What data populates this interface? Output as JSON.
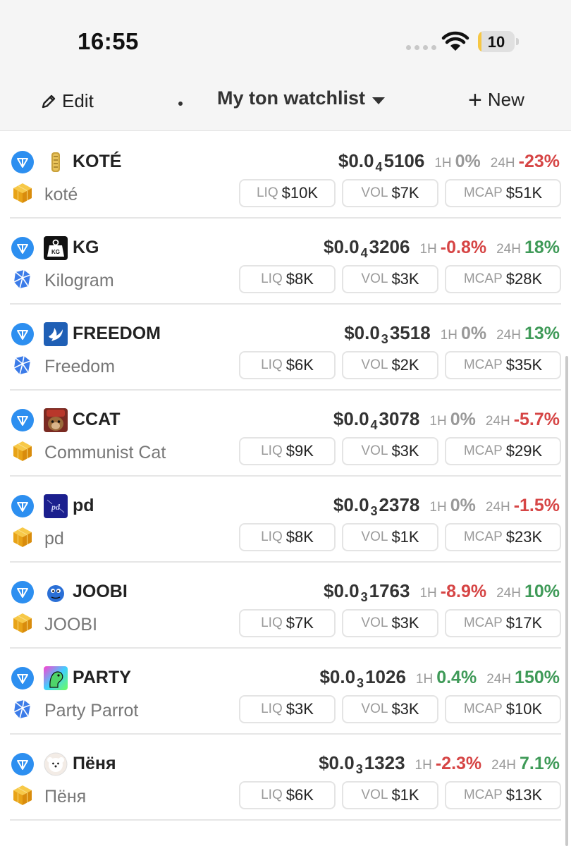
{
  "status_bar": {
    "time": "16:55",
    "battery": "10",
    "battery_level": 0.1
  },
  "header": {
    "edit_label": "Edit",
    "title": "My ton watchlist",
    "new_label": "New"
  },
  "labels": {
    "liq": "LIQ",
    "vol": "VOL",
    "mcap": "MCAP",
    "h1": "1H",
    "h24": "24H"
  },
  "tokens": [
    {
      "symbol": "KOTÉ",
      "name": "koté",
      "price_prefix": "$0.0",
      "price_sub": "4",
      "price_main": "5106",
      "change_1h": "0%",
      "change_1h_dir": "zero",
      "change_24h": "-23%",
      "change_24h_dir": "neg",
      "liq": "$10K",
      "vol": "$7K",
      "mcap": "$51K",
      "dex": "cube-icon",
      "logo": "coin-icon"
    },
    {
      "symbol": "KG",
      "name": "Kilogram",
      "price_prefix": "$0.0",
      "price_sub": "4",
      "price_main": "3206",
      "change_1h": "-0.8%",
      "change_1h_dir": "neg",
      "change_24h": "18%",
      "change_24h_dir": "pos",
      "liq": "$8K",
      "vol": "$3K",
      "mcap": "$28K",
      "dex": "stonfi-icon",
      "logo": "kg-weight-icon"
    },
    {
      "symbol": "FREEDOM",
      "name": "Freedom",
      "price_prefix": "$0.0",
      "price_sub": "3",
      "price_main": "3518",
      "change_1h": "0%",
      "change_1h_dir": "zero",
      "change_24h": "13%",
      "change_24h_dir": "pos",
      "liq": "$6K",
      "vol": "$2K",
      "mcap": "$35K",
      "dex": "stonfi-icon",
      "logo": "dove-icon"
    },
    {
      "symbol": "CCAT",
      "name": "Communist Cat",
      "price_prefix": "$0.0",
      "price_sub": "4",
      "price_main": "3078",
      "change_1h": "0%",
      "change_1h_dir": "zero",
      "change_24h": "-5.7%",
      "change_24h_dir": "neg",
      "liq": "$9K",
      "vol": "$3K",
      "mcap": "$29K",
      "dex": "cube-icon",
      "logo": "cat-icon"
    },
    {
      "symbol": "pd",
      "name": "pd",
      "price_prefix": "$0.0",
      "price_sub": "3",
      "price_main": "2378",
      "change_1h": "0%",
      "change_1h_dir": "zero",
      "change_24h": "-1.5%",
      "change_24h_dir": "neg",
      "liq": "$8K",
      "vol": "$1K",
      "mcap": "$23K",
      "dex": "cube-icon",
      "logo": "pd-icon"
    },
    {
      "symbol": "JOOBI",
      "name": "JOOBI",
      "price_prefix": "$0.0",
      "price_sub": "3",
      "price_main": "1763",
      "change_1h": "-8.9%",
      "change_1h_dir": "neg",
      "change_24h": "10%",
      "change_24h_dir": "pos",
      "liq": "$7K",
      "vol": "$3K",
      "mcap": "$17K",
      "dex": "cube-icon",
      "logo": "blue-ball-icon"
    },
    {
      "symbol": "PARTY",
      "name": "Party Parrot",
      "price_prefix": "$0.0",
      "price_sub": "3",
      "price_main": "1026",
      "change_1h": "0.4%",
      "change_1h_dir": "pos",
      "change_24h": "150%",
      "change_24h_dir": "pos",
      "liq": "$3K",
      "vol": "$3K",
      "mcap": "$10K",
      "dex": "stonfi-icon",
      "logo": "parrot-icon"
    },
    {
      "symbol": "Пёня",
      "name": "Пёня",
      "price_prefix": "$0.0",
      "price_sub": "3",
      "price_main": "1323",
      "change_1h": "-2.3%",
      "change_1h_dir": "neg",
      "change_24h": "7.1%",
      "change_24h_dir": "pos",
      "liq": "$6K",
      "vol": "$1K",
      "mcap": "$13K",
      "dex": "cube-icon",
      "logo": "dog-icon"
    }
  ],
  "colors": {
    "ton_blue": "#2d8ff0",
    "negative": "#d64545",
    "positive": "#3f9a58",
    "neutral": "#999999"
  }
}
